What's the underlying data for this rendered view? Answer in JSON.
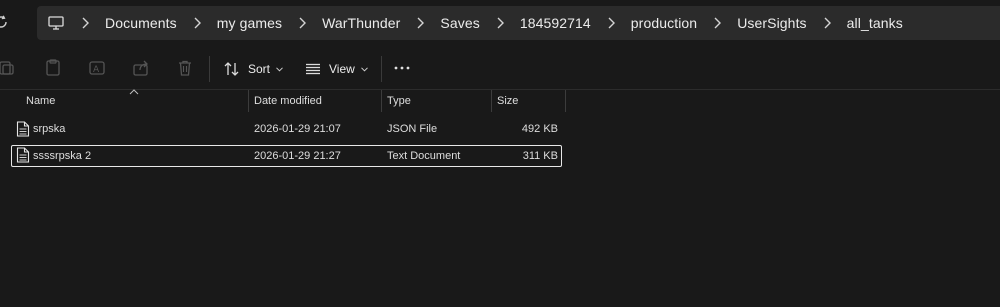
{
  "breadcrumb": [
    "Documents",
    "my games",
    "WarThunder",
    "Saves",
    "184592714",
    "production",
    "UserSights",
    "all_tanks"
  ],
  "toolbar": {
    "sort_label": "Sort",
    "view_label": "View"
  },
  "columns": {
    "name": "Name",
    "date_modified": "Date modified",
    "type": "Type",
    "size": "Size"
  },
  "files": [
    {
      "name": "srpska",
      "date_modified": "2026-01-29 21:07",
      "type": "JSON File",
      "size": "492 KB",
      "selected": false
    },
    {
      "name": "ssssrpska 2",
      "date_modified": "2026-01-29 21:27",
      "type": "Text Document",
      "size": "311 KB",
      "selected": true
    }
  ]
}
